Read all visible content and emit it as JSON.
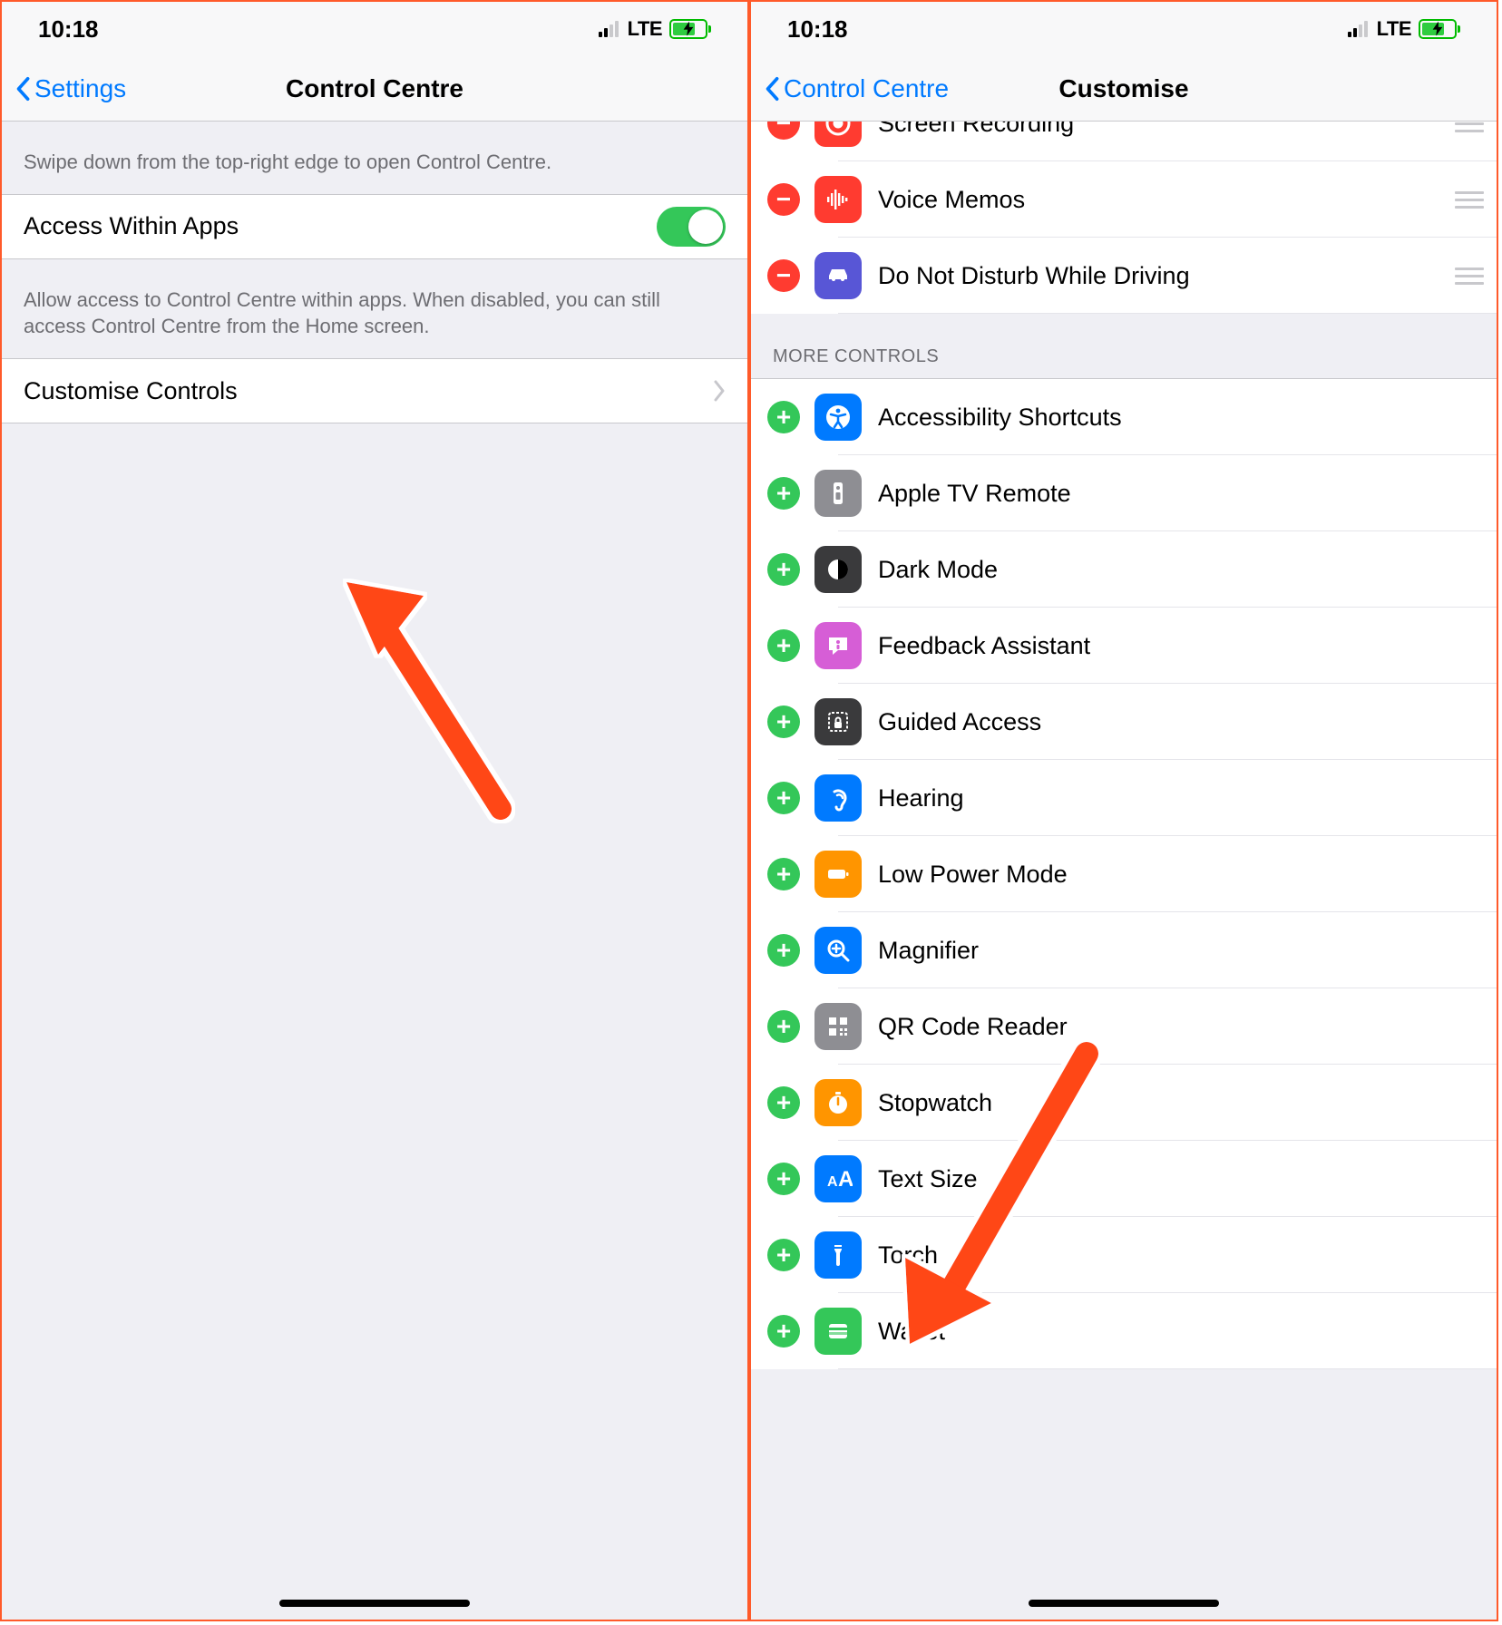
{
  "status": {
    "time": "10:18",
    "carrier": "LTE"
  },
  "left": {
    "back": "Settings",
    "title": "Control Centre",
    "hint1": "Swipe down from the top-right edge to open Control Centre.",
    "toggle_label": "Access Within Apps",
    "hint2": "Allow access to Control Centre within apps. When disabled, you can still access Control Centre from the Home screen.",
    "customise": "Customise Controls"
  },
  "right": {
    "back": "Control Centre",
    "title": "Customise",
    "more_controls": "MORE CONTROLS",
    "included": [
      {
        "id": "screen-recording",
        "label": "Screen Recording",
        "icon": "record-icon",
        "color": "ic-red"
      },
      {
        "id": "voice-memos",
        "label": "Voice Memos",
        "icon": "waveform-icon",
        "color": "ic-red"
      },
      {
        "id": "do-not-disturb-driving",
        "label": "Do Not Disturb While Driving",
        "icon": "car-icon",
        "color": "ic-purple"
      }
    ],
    "more": [
      {
        "id": "accessibility-shortcuts",
        "label": "Accessibility Shortcuts",
        "icon": "accessibility-icon",
        "color": "ic-blue"
      },
      {
        "id": "apple-tv-remote",
        "label": "Apple TV Remote",
        "icon": "remote-icon",
        "color": "ic-gray"
      },
      {
        "id": "dark-mode",
        "label": "Dark Mode",
        "icon": "darkmode-icon",
        "color": "ic-dgray"
      },
      {
        "id": "feedback-assistant",
        "label": "Feedback Assistant",
        "icon": "feedback-icon",
        "color": "ic-pink"
      },
      {
        "id": "guided-access",
        "label": "Guided Access",
        "icon": "lock-icon",
        "color": "ic-dgray"
      },
      {
        "id": "hearing",
        "label": "Hearing",
        "icon": "ear-icon",
        "color": "ic-blue"
      },
      {
        "id": "low-power-mode",
        "label": "Low Power Mode",
        "icon": "battery-icon",
        "color": "ic-orange"
      },
      {
        "id": "magnifier",
        "label": "Magnifier",
        "icon": "magnifier-icon",
        "color": "ic-blue"
      },
      {
        "id": "qr-code-reader",
        "label": "QR Code Reader",
        "icon": "qr-icon",
        "color": "ic-gray"
      },
      {
        "id": "stopwatch",
        "label": "Stopwatch",
        "icon": "stopwatch-icon",
        "color": "ic-orange"
      },
      {
        "id": "text-size",
        "label": "Text Size",
        "icon": "textsize-icon",
        "color": "ic-blue"
      },
      {
        "id": "torch",
        "label": "Torch",
        "icon": "torch-icon",
        "color": "ic-blue"
      },
      {
        "id": "wallet",
        "label": "Wallet",
        "icon": "wallet-icon",
        "color": "ic-green"
      }
    ]
  }
}
